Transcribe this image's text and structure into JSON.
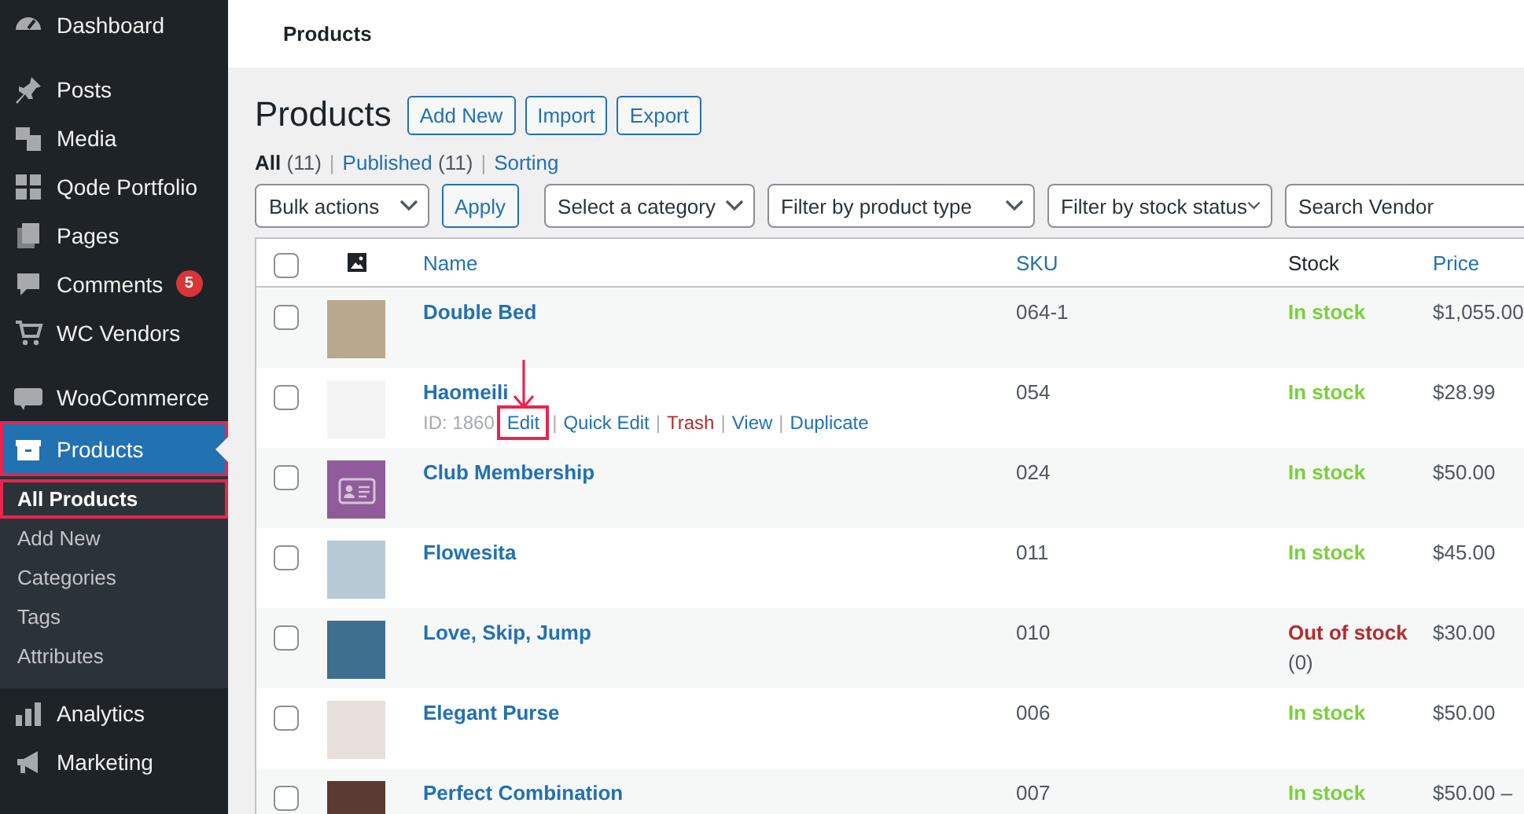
{
  "sidebar": {
    "groups": [
      [
        {
          "label": "Dashboard",
          "selected": false,
          "highlighted": false
        }
      ],
      [
        {
          "label": "Posts",
          "selected": false,
          "highlighted": false
        },
        {
          "label": "Media",
          "selected": false,
          "highlighted": false
        },
        {
          "label": "Qode Portfolio",
          "selected": false,
          "highlighted": false
        },
        {
          "label": "Pages",
          "selected": false,
          "highlighted": false
        },
        {
          "label": "Comments",
          "selected": false,
          "highlighted": false,
          "badge": "5"
        },
        {
          "label": "WC Vendors",
          "selected": false,
          "highlighted": false
        }
      ],
      [
        {
          "label": "WooCommerce",
          "selected": false,
          "highlighted": false
        },
        {
          "label": "Products",
          "selected": true,
          "highlighted": true,
          "children": [
            {
              "label": "All Products",
              "selected": true,
              "highlighted": true
            },
            {
              "label": "Add New",
              "selected": false,
              "highlighted": false
            },
            {
              "label": "Categories",
              "selected": false,
              "highlighted": false
            },
            {
              "label": "Tags",
              "selected": false,
              "highlighted": false
            },
            {
              "label": "Attributes",
              "selected": false,
              "highlighted": false
            }
          ]
        },
        {
          "label": "Analytics",
          "selected": false,
          "highlighted": false
        },
        {
          "label": "Marketing",
          "selected": false,
          "highlighted": false
        }
      ]
    ]
  },
  "top_bar": {
    "title": "Products"
  },
  "page": {
    "title": "Products",
    "buttons": [
      "Add New",
      "Import",
      "Export"
    ]
  },
  "views": {
    "separator": "|",
    "items": [
      {
        "label": "All",
        "count": "(11)",
        "selected": true
      },
      {
        "label": "Published",
        "count": "(11)",
        "selected": false
      },
      {
        "label": "Sorting",
        "selected": false
      }
    ]
  },
  "filters": {
    "bulk_actions": "Bulk actions",
    "apply": "Apply",
    "selects": [
      "Select a category",
      "Filter by product type",
      "Filter by stock status"
    ],
    "search": {
      "placeholder": "Search Vendor"
    }
  },
  "table": {
    "columns": [
      {
        "kind": "check",
        "checked": false
      },
      {
        "kind": "image"
      },
      {
        "kind": "link",
        "label": "Name"
      },
      {
        "kind": "link",
        "label": "SKU"
      },
      {
        "kind": "text",
        "label": "Stock"
      },
      {
        "kind": "link",
        "label": "Price"
      }
    ],
    "rows": [
      {
        "checked": false,
        "thumb": {
          "kind": "photo"
        },
        "name": "Double Bed",
        "sku": "064-1",
        "stock": {
          "kind": "in",
          "status": "In stock"
        },
        "price": "$1,055.00"
      },
      {
        "checked": false,
        "thumb": {
          "kind": "photo"
        },
        "name": "Haomeili",
        "id": "ID: 1860",
        "separator": "|",
        "actions": [
          {
            "label": "Edit",
            "kind": "link",
            "highlighted": true
          },
          {
            "label": "Quick Edit",
            "kind": "link",
            "highlighted": false
          },
          {
            "label": "Trash",
            "kind": "danger",
            "highlighted": false
          },
          {
            "label": "View",
            "kind": "link",
            "highlighted": false
          },
          {
            "label": "Duplicate",
            "kind": "link",
            "highlighted": false
          }
        ],
        "sku": "054",
        "stock": {
          "kind": "in",
          "status": "In stock"
        },
        "price": "$28.99"
      },
      {
        "checked": false,
        "thumb": {
          "kind": "icon"
        },
        "name": "Club Membership",
        "sku": "024",
        "stock": {
          "kind": "in",
          "status": "In stock"
        },
        "price": "$50.00"
      },
      {
        "checked": false,
        "thumb": {
          "kind": "photo"
        },
        "name": "Flowesita",
        "sku": "011",
        "stock": {
          "kind": "in",
          "status": "In stock"
        },
        "price": "$45.00"
      },
      {
        "checked": false,
        "thumb": {
          "kind": "photo"
        },
        "name": "Love, Skip, Jump",
        "sku": "010",
        "stock": {
          "kind": "out",
          "status": "Out of stock",
          "count": "(0)"
        },
        "price": "$30.00"
      },
      {
        "checked": false,
        "thumb": {
          "kind": "photo"
        },
        "name": "Elegant Purse",
        "sku": "006",
        "stock": {
          "kind": "in",
          "status": "In stock"
        },
        "price": "$50.00"
      },
      {
        "checked": false,
        "thumb": {
          "kind": "photo"
        },
        "name": "Perfect Combination",
        "sku": "007",
        "stock": {
          "kind": "in",
          "status": "In stock"
        },
        "price": "$50.00 –"
      }
    ]
  }
}
